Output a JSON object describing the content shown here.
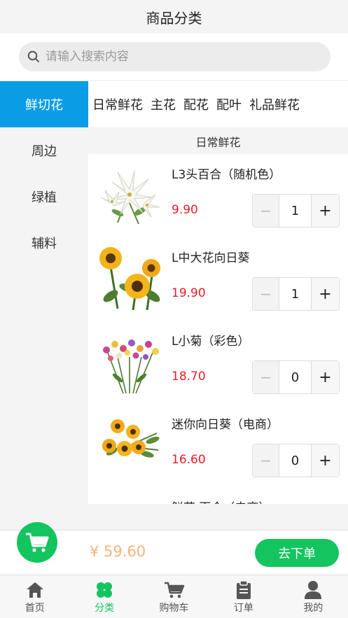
{
  "header": {
    "title": "商品分类"
  },
  "search": {
    "placeholder": "请输入搜索内容"
  },
  "sidebar": {
    "items": [
      {
        "label": "鲜切花",
        "active": true
      },
      {
        "label": "周边"
      },
      {
        "label": "绿植"
      },
      {
        "label": "辅料"
      }
    ]
  },
  "subtabs": [
    "日常鲜花",
    "主花",
    "配花",
    "配叶",
    "礼品鲜花"
  ],
  "section": {
    "title": "日常鲜花"
  },
  "products": [
    {
      "name": "L3头百合（随机色）",
      "price": "9.90",
      "qty": "1"
    },
    {
      "name": "L中大花向日葵",
      "price": "19.90",
      "qty": "1"
    },
    {
      "name": "L小菊（彩色）",
      "price": "18.70",
      "qty": "0"
    },
    {
      "name": "迷你向日葵（电商）",
      "price": "16.60",
      "qty": "0"
    },
    {
      "name": "鲜花 百合（电商）",
      "price": "",
      "qty": ""
    }
  ],
  "stepper": {
    "minus": "−",
    "plus": "+"
  },
  "cart": {
    "total": "¥ 59.60",
    "checkout_label": "去下单"
  },
  "tabbar": [
    {
      "label": "首页",
      "icon": "home-icon"
    },
    {
      "label": "分类",
      "icon": "category-icon",
      "active": true
    },
    {
      "label": "购物车",
      "icon": "cart-icon"
    },
    {
      "label": "订单",
      "icon": "order-icon"
    },
    {
      "label": "我的",
      "icon": "user-icon"
    }
  ],
  "colors": {
    "accent": "#0a9de6",
    "green": "#14c45e",
    "price": "#ee1c25",
    "total": "#f7b27a"
  }
}
